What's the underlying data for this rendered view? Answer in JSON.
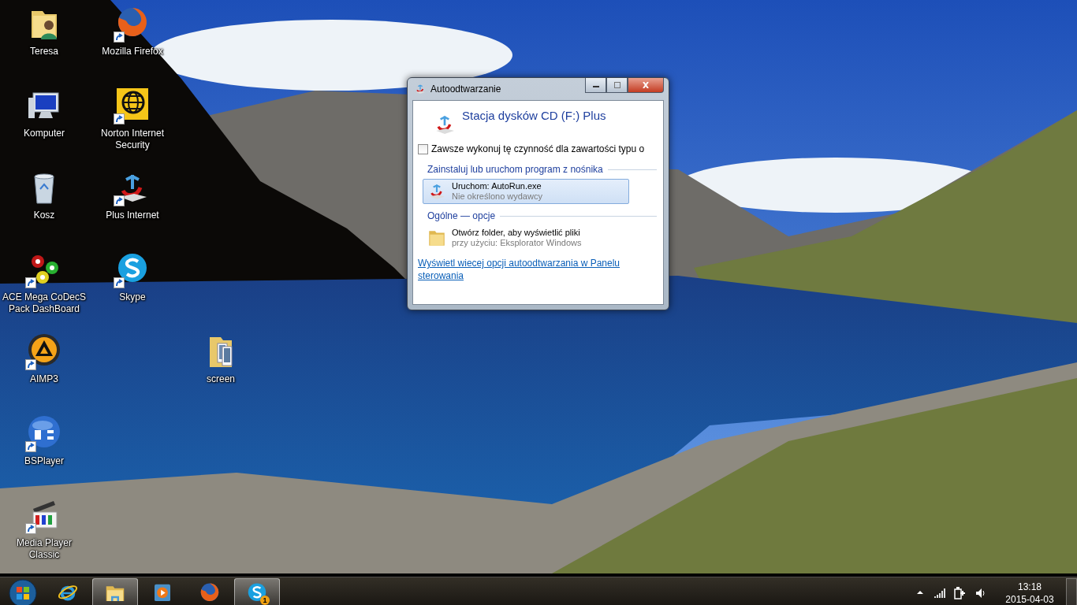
{
  "desktop_icons": [
    {
      "label": "Teresa",
      "kind": "user-folder",
      "shortcut": false
    },
    {
      "label": "Komputer",
      "kind": "computer",
      "shortcut": false
    },
    {
      "label": "Kosz",
      "kind": "bin",
      "shortcut": false
    },
    {
      "label": "ACE Mega CoDecS Pack DashBoard",
      "kind": "gears",
      "shortcut": true
    },
    {
      "label": "AIMP3",
      "kind": "aimp",
      "shortcut": true
    },
    {
      "label": "BSPlayer",
      "kind": "bs",
      "shortcut": true
    },
    {
      "label": "Media Player Classic",
      "kind": "clapper",
      "shortcut": true
    },
    {
      "label": "Mozilla Firefox",
      "kind": "firefox",
      "shortcut": true
    },
    {
      "label": "Norton Internet Security",
      "kind": "norton",
      "shortcut": true
    },
    {
      "label": "Plus Internet",
      "kind": "plus",
      "shortcut": true
    },
    {
      "label": "Skype",
      "kind": "skype",
      "shortcut": true
    },
    {
      "label": "screen",
      "kind": "photo-folder",
      "shortcut": false
    }
  ],
  "dialog": {
    "title": "Autoodtwarzanie",
    "heading": "Stacja dysków CD (F:) Plus",
    "checkbox": {
      "label": "Zawsze wykonuj tę czynność dla zawartości typu o",
      "checked": false
    },
    "sections": [
      {
        "title": "Zainstaluj lub uruchom program z nośnika",
        "options": [
          {
            "kind": "plus",
            "title": "Uruchom: AutoRun.exe",
            "subtitle": "Nie określono wydawcy",
            "selected": true
          }
        ]
      },
      {
        "title": "Ogólne — opcje",
        "options": [
          {
            "kind": "folder",
            "title": "Otwórz folder, aby wyświetlić pliki",
            "subtitle": "przy użyciu: Eksplorator Windows",
            "selected": false
          }
        ]
      }
    ],
    "link": "Wyświetl wiecej opcji autoodtwarzania w Panelu sterowania"
  },
  "taskbar": {
    "buttons": [
      {
        "kind": "ie",
        "open": false
      },
      {
        "kind": "explorer",
        "open": true
      },
      {
        "kind": "media",
        "open": false
      },
      {
        "kind": "firefox",
        "open": false
      },
      {
        "kind": "skype",
        "open": true,
        "badge": "1"
      }
    ],
    "time": "13:18",
    "date": "2015-04-03"
  }
}
